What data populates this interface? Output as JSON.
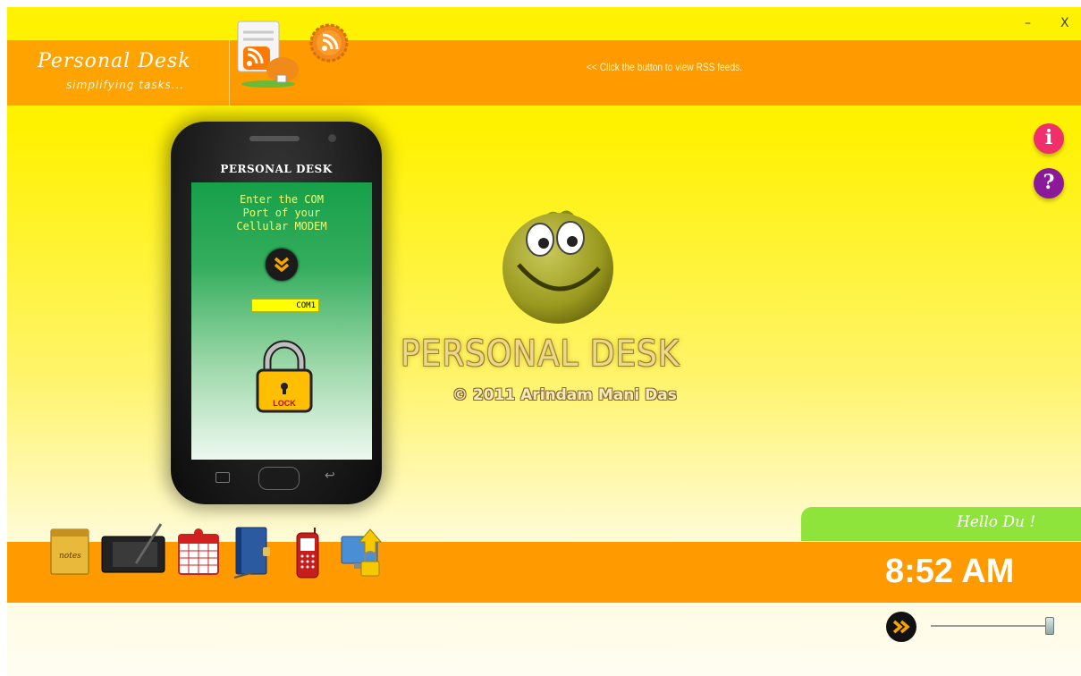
{
  "window": {
    "minimize_label": "–",
    "close_label": "X"
  },
  "header": {
    "title": "Personal Desk",
    "subtitle": "simplifying tasks...",
    "rss_hint": "<< Click the button to view RSS feeds.",
    "icons": [
      "rss-reader-icon",
      "rss-feed-icon"
    ]
  },
  "phone": {
    "title": "PERSONAL DESK",
    "prompt": "Enter the COM\nPort of your\nCellular MODEM",
    "com_port_value": "COM1",
    "lock_label": "LOCK",
    "icons": [
      "chevron-down-icon",
      "padlock-icon",
      "menu-icon",
      "home-button",
      "back-icon"
    ]
  },
  "brand": {
    "title": "PERSONAL DESK",
    "copyright": "© 2011 Arindam Mani Das"
  },
  "side_buttons": [
    {
      "name": "info",
      "label": "i",
      "color": "#f0306a"
    },
    {
      "name": "help",
      "label": "?",
      "color": "#8a1a9a"
    }
  ],
  "dock": {
    "notes_label": "notes",
    "icons": [
      "notes-icon",
      "drawing-tablet-icon",
      "calendar-icon",
      "address-book-icon",
      "mobile-phone-icon",
      "screen-lock-icon"
    ]
  },
  "footer": {
    "greeting": "Hello Du !",
    "clock": "8:52 AM",
    "slider_level": 1.0
  },
  "colors": {
    "accent_orange": "#ff9a00",
    "background_yellow": "#fff200",
    "greeting_green": "#8ee43a"
  }
}
